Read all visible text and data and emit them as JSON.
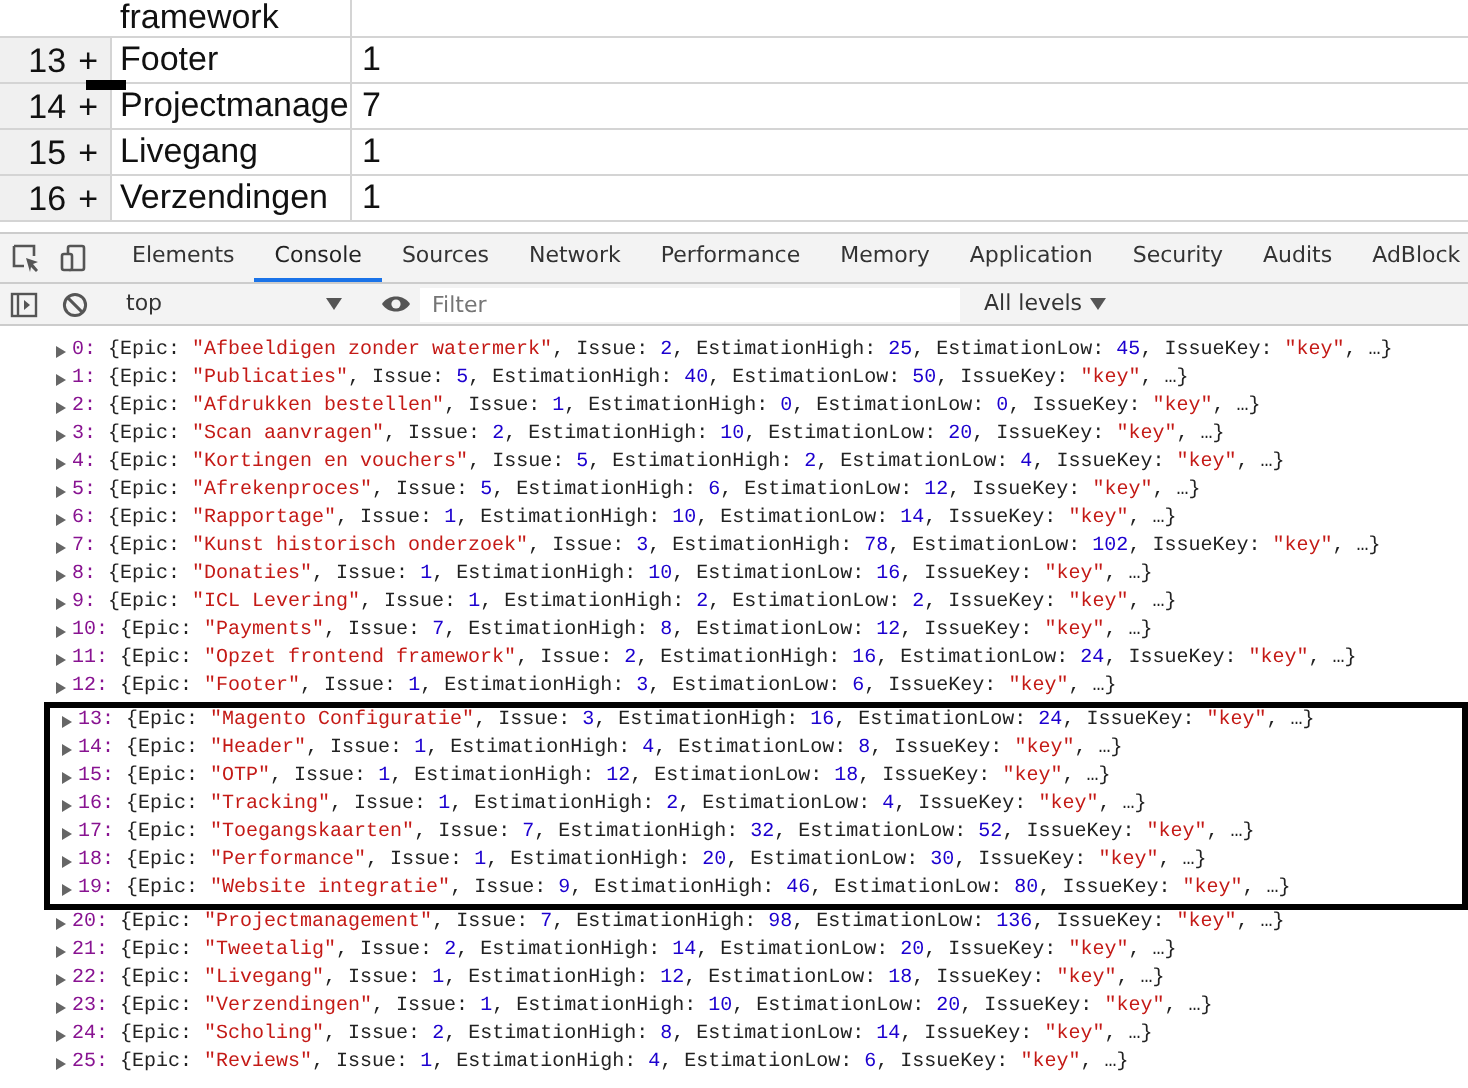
{
  "table": {
    "partial_row": {
      "name": "framework"
    },
    "rows": [
      {
        "number": "13",
        "toggle": "+",
        "name": "Footer",
        "value": "1"
      },
      {
        "number": "14",
        "toggle": "+",
        "name": "Projectmanage",
        "value": "7"
      },
      {
        "number": "15",
        "toggle": "+",
        "name": "Livegang",
        "value": "1"
      },
      {
        "number": "16",
        "toggle": "+",
        "name": "Verzendingen",
        "value": "1"
      }
    ]
  },
  "devtools": {
    "tabs": [
      {
        "label": "Elements",
        "selected": false
      },
      {
        "label": "Console",
        "selected": true
      },
      {
        "label": "Sources",
        "selected": false
      },
      {
        "label": "Network",
        "selected": false
      },
      {
        "label": "Performance",
        "selected": false
      },
      {
        "label": "Memory",
        "selected": false
      },
      {
        "label": "Application",
        "selected": false
      },
      {
        "label": "Security",
        "selected": false
      },
      {
        "label": "Audits",
        "selected": false
      },
      {
        "label": "AdBlock",
        "selected": false
      }
    ],
    "toolbar": {
      "context": "top",
      "filter": {
        "placeholder": "Filter"
      },
      "levels": "All levels"
    },
    "console_entries": [
      {
        "text": "0: {Epic: \"Afbeeldigen zonder watermerk\", Issue: 2, EstimationHigh: 25, EstimationLow: 45, IssueKey: \"key\", …}",
        "highlighted": false
      },
      {
        "text": "1: {Epic: \"Publicaties\", Issue: 5, EstimationHigh: 40, EstimationLow: 50, IssueKey: \"key\", …}",
        "highlighted": false
      },
      {
        "text": "2: {Epic: \"Afdrukken bestellen\", Issue: 1, EstimationHigh: 0, EstimationLow: 0, IssueKey: \"key\", …}",
        "highlighted": false
      },
      {
        "text": "3: {Epic: \"Scan aanvragen\", Issue: 2, EstimationHigh: 10, EstimationLow: 20, IssueKey: \"key\", …}",
        "highlighted": false
      },
      {
        "text": "4: {Epic: \"Kortingen en vouchers\", Issue: 5, EstimationHigh: 2, EstimationLow: 4, IssueKey: \"key\", …}",
        "highlighted": false
      },
      {
        "text": "5: {Epic: \"Afrekenproces\", Issue: 5, EstimationHigh: 6, EstimationLow: 12, IssueKey: \"key\", …}",
        "highlighted": false
      },
      {
        "text": "6: {Epic: \"Rapportage\", Issue: 1, EstimationHigh: 10, EstimationLow: 14, IssueKey: \"key\", …}",
        "highlighted": false
      },
      {
        "text": "7: {Epic: \"Kunst historisch onderzoek\", Issue: 3, EstimationHigh: 78, EstimationLow: 102, IssueKey: \"key\", …}",
        "highlighted": false
      },
      {
        "text": "8: {Epic: \"Donaties\", Issue: 1, EstimationHigh: 10, EstimationLow: 16, IssueKey: \"key\", …}",
        "highlighted": false
      },
      {
        "text": "9: {Epic: \"ICL Levering\", Issue: 1, EstimationHigh: 2, EstimationLow: 2, IssueKey: \"key\", …}",
        "highlighted": false
      },
      {
        "text": "10: {Epic: \"Payments\", Issue: 7, EstimationHigh: 8, EstimationLow: 12, IssueKey: \"key\", …}",
        "highlighted": false
      },
      {
        "text": "11: {Epic: \"Opzet frontend framework\", Issue: 2, EstimationHigh: 16, EstimationLow: 24, IssueKey: \"key\", …}",
        "highlighted": false
      },
      {
        "text": "12: {Epic: \"Footer\", Issue: 1, EstimationHigh: 3, EstimationLow: 6, IssueKey: \"key\", …}",
        "highlighted": false
      },
      {
        "text": "13: {Epic: \"Magento Configuratie\", Issue: 3, EstimationHigh: 16, EstimationLow: 24, IssueKey: \"key\", …}",
        "highlighted": true
      },
      {
        "text": "14: {Epic: \"Header\", Issue: 1, EstimationHigh: 4, EstimationLow: 8, IssueKey: \"key\", …}",
        "highlighted": true
      },
      {
        "text": "15: {Epic: \"OTP\", Issue: 1, EstimationHigh: 12, EstimationLow: 18, IssueKey: \"key\", …}",
        "highlighted": true
      },
      {
        "text": "16: {Epic: \"Tracking\", Issue: 1, EstimationHigh: 2, EstimationLow: 4, IssueKey: \"key\", …}",
        "highlighted": true
      },
      {
        "text": "17: {Epic: \"Toegangskaarten\", Issue: 7, EstimationHigh: 32, EstimationLow: 52, IssueKey: \"key\", …}",
        "highlighted": true
      },
      {
        "text": "18: {Epic: \"Performance\", Issue: 1, EstimationHigh: 20, EstimationLow: 30, IssueKey: \"key\", …}",
        "highlighted": true
      },
      {
        "text": "19: {Epic: \"Website integratie\", Issue: 9, EstimationHigh: 46, EstimationLow: 80, IssueKey: \"key\", …}",
        "highlighted": true
      },
      {
        "text": "20: {Epic: \"Projectmanagement\", Issue: 7, EstimationHigh: 98, EstimationLow: 136, IssueKey: \"key\", …}",
        "highlighted": false
      },
      {
        "text": "21: {Epic: \"Tweetalig\", Issue: 2, EstimationHigh: 14, EstimationLow: 20, IssueKey: \"key\", …}",
        "highlighted": false
      },
      {
        "text": "22: {Epic: \"Livegang\", Issue: 1, EstimationHigh: 12, EstimationLow: 18, IssueKey: \"key\", …}",
        "highlighted": false
      },
      {
        "text": "23: {Epic: \"Verzendingen\", Issue: 1, EstimationHigh: 10, EstimationLow: 20, IssueKey: \"key\", …}",
        "highlighted": false
      },
      {
        "text": "24: {Epic: \"Scholing\", Issue: 2, EstimationHigh: 8, EstimationLow: 14, IssueKey: \"key\", …}",
        "highlighted": false
      },
      {
        "text": "25: {Epic: \"Reviews\", Issue: 1, EstimationHigh: 4, EstimationLow: 6, IssueKey: \"key\", …}",
        "highlighted": false
      }
    ]
  }
}
